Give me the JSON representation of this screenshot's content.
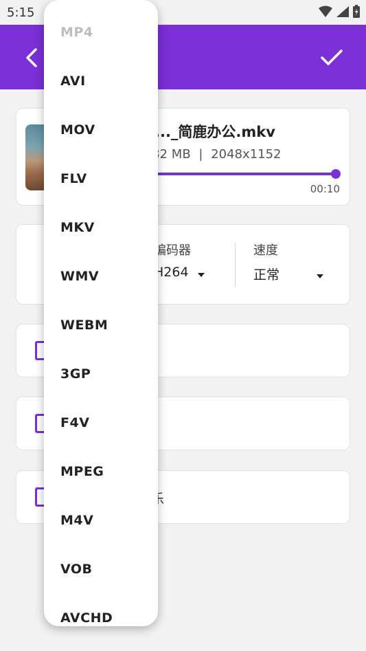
{
  "status_bar": {
    "time": "5:15"
  },
  "video": {
    "file_name": "白..._简鹿办公.mkv",
    "file_size": "6.82 MB",
    "separator": "|",
    "resolution": "2048x1152",
    "time_end": "00:10",
    "progress": 1.0
  },
  "options": {
    "encoder_label": "编码器",
    "encoder_value": "H264",
    "speed_label": "速度",
    "speed_value": "正常"
  },
  "rows": [
    {
      "text": ""
    },
    {
      "text": ""
    },
    {
      "text": "乐"
    }
  ],
  "format_dropdown": {
    "selected": "MP4",
    "items": [
      "MP4",
      "AVI",
      "MOV",
      "FLV",
      "MKV",
      "WMV",
      "WEBM",
      "3GP",
      "F4V",
      "MPEG",
      "M4V",
      "VOB",
      "AVCHD"
    ]
  },
  "colors": {
    "accent": "#7b2fd6",
    "background": "#f2f2f2"
  }
}
